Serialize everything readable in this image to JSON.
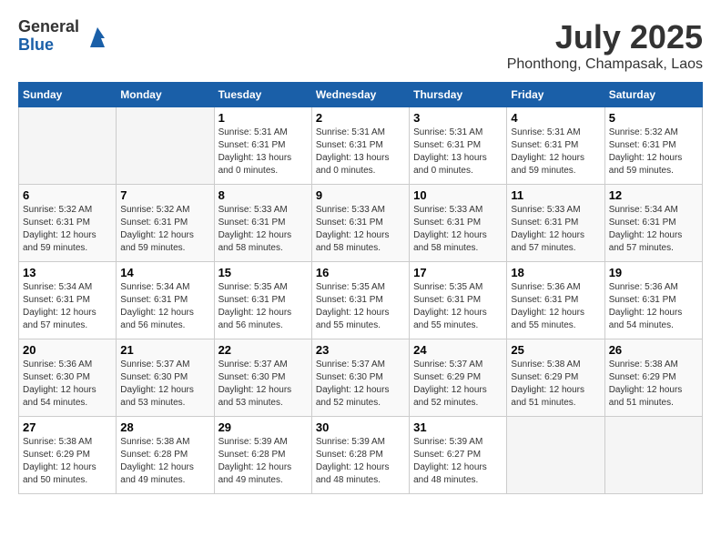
{
  "header": {
    "logo_general": "General",
    "logo_blue": "Blue",
    "month_title": "July 2025",
    "location": "Phonthong, Champasak, Laos"
  },
  "days_of_week": [
    "Sunday",
    "Monday",
    "Tuesday",
    "Wednesday",
    "Thursday",
    "Friday",
    "Saturday"
  ],
  "weeks": [
    [
      {
        "day": "",
        "info": ""
      },
      {
        "day": "",
        "info": ""
      },
      {
        "day": "1",
        "sunrise": "5:31 AM",
        "sunset": "6:31 PM",
        "daylight": "13 hours and 0 minutes."
      },
      {
        "day": "2",
        "sunrise": "5:31 AM",
        "sunset": "6:31 PM",
        "daylight": "13 hours and 0 minutes."
      },
      {
        "day": "3",
        "sunrise": "5:31 AM",
        "sunset": "6:31 PM",
        "daylight": "13 hours and 0 minutes."
      },
      {
        "day": "4",
        "sunrise": "5:31 AM",
        "sunset": "6:31 PM",
        "daylight": "12 hours and 59 minutes."
      },
      {
        "day": "5",
        "sunrise": "5:32 AM",
        "sunset": "6:31 PM",
        "daylight": "12 hours and 59 minutes."
      }
    ],
    [
      {
        "day": "6",
        "sunrise": "5:32 AM",
        "sunset": "6:31 PM",
        "daylight": "12 hours and 59 minutes."
      },
      {
        "day": "7",
        "sunrise": "5:32 AM",
        "sunset": "6:31 PM",
        "daylight": "12 hours and 59 minutes."
      },
      {
        "day": "8",
        "sunrise": "5:33 AM",
        "sunset": "6:31 PM",
        "daylight": "12 hours and 58 minutes."
      },
      {
        "day": "9",
        "sunrise": "5:33 AM",
        "sunset": "6:31 PM",
        "daylight": "12 hours and 58 minutes."
      },
      {
        "day": "10",
        "sunrise": "5:33 AM",
        "sunset": "6:31 PM",
        "daylight": "12 hours and 58 minutes."
      },
      {
        "day": "11",
        "sunrise": "5:33 AM",
        "sunset": "6:31 PM",
        "daylight": "12 hours and 57 minutes."
      },
      {
        "day": "12",
        "sunrise": "5:34 AM",
        "sunset": "6:31 PM",
        "daylight": "12 hours and 57 minutes."
      }
    ],
    [
      {
        "day": "13",
        "sunrise": "5:34 AM",
        "sunset": "6:31 PM",
        "daylight": "12 hours and 57 minutes."
      },
      {
        "day": "14",
        "sunrise": "5:34 AM",
        "sunset": "6:31 PM",
        "daylight": "12 hours and 56 minutes."
      },
      {
        "day": "15",
        "sunrise": "5:35 AM",
        "sunset": "6:31 PM",
        "daylight": "12 hours and 56 minutes."
      },
      {
        "day": "16",
        "sunrise": "5:35 AM",
        "sunset": "6:31 PM",
        "daylight": "12 hours and 55 minutes."
      },
      {
        "day": "17",
        "sunrise": "5:35 AM",
        "sunset": "6:31 PM",
        "daylight": "12 hours and 55 minutes."
      },
      {
        "day": "18",
        "sunrise": "5:36 AM",
        "sunset": "6:31 PM",
        "daylight": "12 hours and 55 minutes."
      },
      {
        "day": "19",
        "sunrise": "5:36 AM",
        "sunset": "6:31 PM",
        "daylight": "12 hours and 54 minutes."
      }
    ],
    [
      {
        "day": "20",
        "sunrise": "5:36 AM",
        "sunset": "6:30 PM",
        "daylight": "12 hours and 54 minutes."
      },
      {
        "day": "21",
        "sunrise": "5:37 AM",
        "sunset": "6:30 PM",
        "daylight": "12 hours and 53 minutes."
      },
      {
        "day": "22",
        "sunrise": "5:37 AM",
        "sunset": "6:30 PM",
        "daylight": "12 hours and 53 minutes."
      },
      {
        "day": "23",
        "sunrise": "5:37 AM",
        "sunset": "6:30 PM",
        "daylight": "12 hours and 52 minutes."
      },
      {
        "day": "24",
        "sunrise": "5:37 AM",
        "sunset": "6:29 PM",
        "daylight": "12 hours and 52 minutes."
      },
      {
        "day": "25",
        "sunrise": "5:38 AM",
        "sunset": "6:29 PM",
        "daylight": "12 hours and 51 minutes."
      },
      {
        "day": "26",
        "sunrise": "5:38 AM",
        "sunset": "6:29 PM",
        "daylight": "12 hours and 51 minutes."
      }
    ],
    [
      {
        "day": "27",
        "sunrise": "5:38 AM",
        "sunset": "6:29 PM",
        "daylight": "12 hours and 50 minutes."
      },
      {
        "day": "28",
        "sunrise": "5:38 AM",
        "sunset": "6:28 PM",
        "daylight": "12 hours and 49 minutes."
      },
      {
        "day": "29",
        "sunrise": "5:39 AM",
        "sunset": "6:28 PM",
        "daylight": "12 hours and 49 minutes."
      },
      {
        "day": "30",
        "sunrise": "5:39 AM",
        "sunset": "6:28 PM",
        "daylight": "12 hours and 48 minutes."
      },
      {
        "day": "31",
        "sunrise": "5:39 AM",
        "sunset": "6:27 PM",
        "daylight": "12 hours and 48 minutes."
      },
      {
        "day": "",
        "info": ""
      },
      {
        "day": "",
        "info": ""
      }
    ]
  ]
}
